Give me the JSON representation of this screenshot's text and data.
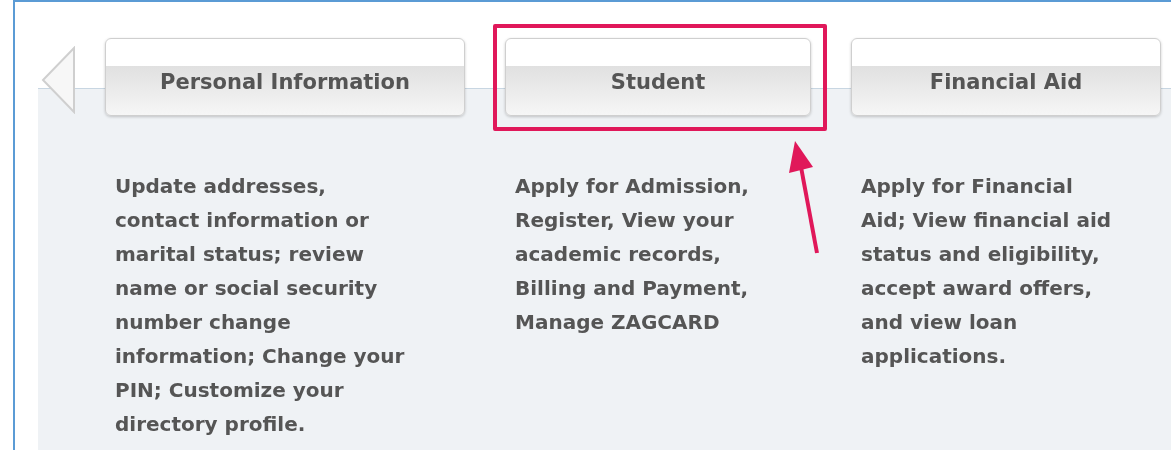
{
  "nav": {
    "previous_arrow": true
  },
  "sections": [
    {
      "tab": "Personal Information",
      "highlighted": false,
      "description": [
        "Update addresses,",
        "contact information or",
        "marital status; review",
        "name or social security",
        "number change",
        "information; Change your",
        "PIN; Customize your",
        "directory profile."
      ]
    },
    {
      "tab": "Student",
      "highlighted": true,
      "description": [
        "Apply for Admission,",
        "Register, View your",
        "academic records,",
        "Billing and Payment,",
        "Manage ZAGCARD"
      ]
    },
    {
      "tab": "Financial Aid",
      "highlighted": false,
      "description": [
        "Apply for Financial",
        "Aid; View financial aid",
        "status and eligibility,",
        "accept award offers,",
        "and view loan",
        "applications."
      ]
    }
  ]
}
